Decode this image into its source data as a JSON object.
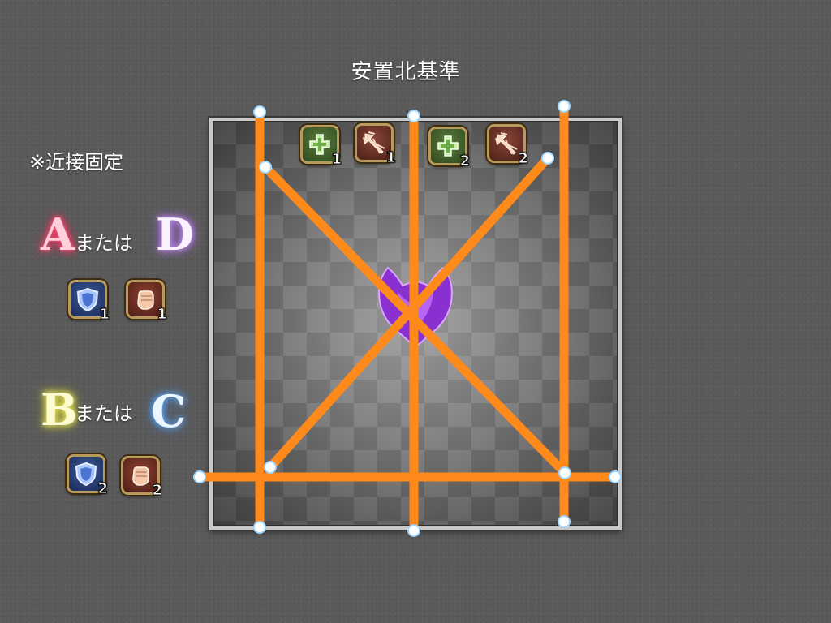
{
  "title": "安置北基準",
  "note": "※近接固定",
  "or_label": "または",
  "markers": {
    "a": "A",
    "d": "D",
    "b": "B",
    "c": "C"
  },
  "party_top": [
    {
      "role": "healer",
      "num": "1",
      "icon": "healer-cross-icon"
    },
    {
      "role": "ranged",
      "num": "1",
      "icon": "ranged-arrows-icon"
    },
    {
      "role": "healer",
      "num": "2",
      "icon": "healer-cross-icon"
    },
    {
      "role": "ranged",
      "num": "2",
      "icon": "ranged-arrows-icon"
    }
  ],
  "party_left": [
    {
      "role": "tank",
      "num": "1",
      "icon": "tank-shield-icon"
    },
    {
      "role": "melee",
      "num": "1",
      "icon": "melee-fist-icon"
    },
    {
      "role": "tank",
      "num": "2",
      "icon": "tank-shield-icon"
    },
    {
      "role": "melee",
      "num": "2",
      "icon": "melee-fist-icon"
    }
  ],
  "colors": {
    "line": "#ff8a1c",
    "handle": "#9fd6ff",
    "marker_a": "#ff4f78",
    "marker_d": "#e8c8ff",
    "marker_b": "#f4f36a",
    "marker_c": "#8fc8ff",
    "boss": "#8a2fd0"
  }
}
